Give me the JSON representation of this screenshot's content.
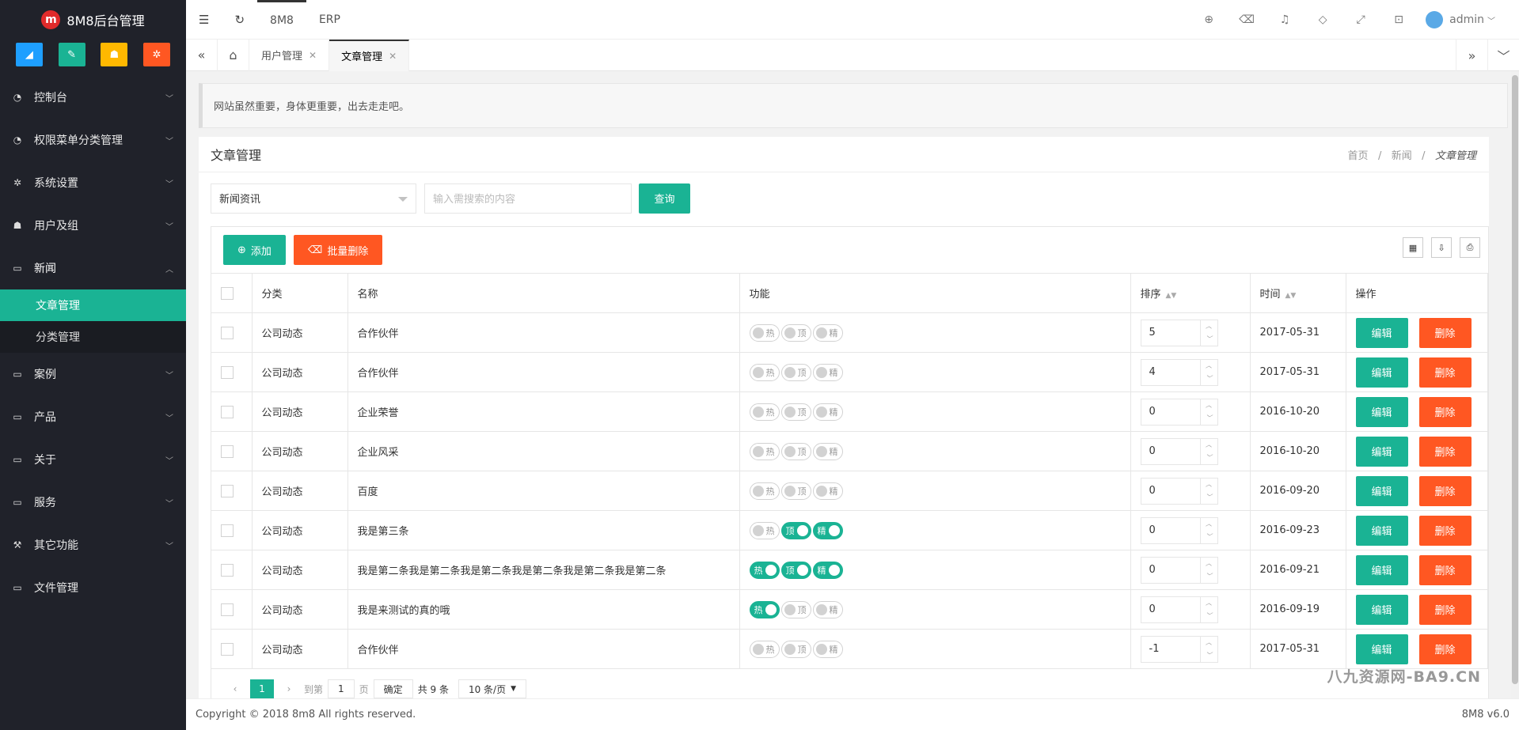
{
  "app": {
    "logo_letter": "m",
    "title": "8M8后台管理"
  },
  "quick_icons": [
    {
      "icon": "chart-icon",
      "color": "#1e9fff"
    },
    {
      "icon": "edit-icon",
      "color": "#1ab394"
    },
    {
      "icon": "users-icon",
      "color": "#ffb800"
    },
    {
      "icon": "gears-icon",
      "color": "#ff5722"
    }
  ],
  "sidebar": {
    "items": [
      {
        "label": "控制台",
        "icon": "dashboard-icon"
      },
      {
        "label": "权限菜单分类管理",
        "icon": "dashboard-icon"
      },
      {
        "label": "系统设置",
        "icon": "gear-icon"
      },
      {
        "label": "用户及组",
        "icon": "users-icon"
      },
      {
        "label": "新闻",
        "icon": "monitor-icon",
        "expanded": true
      },
      {
        "label": "案例",
        "icon": "monitor-icon"
      },
      {
        "label": "产品",
        "icon": "monitor-icon"
      },
      {
        "label": "关于",
        "icon": "monitor-icon"
      },
      {
        "label": "服务",
        "icon": "monitor-icon"
      },
      {
        "label": "其它功能",
        "icon": "gavel-icon"
      },
      {
        "label": "文件管理",
        "icon": "monitor-icon"
      }
    ],
    "subitems": [
      {
        "label": "文章管理",
        "active": true
      },
      {
        "label": "分类管理",
        "active": false
      }
    ]
  },
  "topbar": {
    "tab1": "8M8",
    "tab2": "ERP",
    "user": "admin"
  },
  "tabs": [
    {
      "label": "用户管理",
      "active": false
    },
    {
      "label": "文章管理",
      "active": true
    }
  ],
  "notice": "网站虽然重要，身体更重要，出去走走吧。",
  "panel": {
    "title": "文章管理",
    "breadcrumb": [
      "首页",
      "新闻",
      "文章管理"
    ],
    "select_value": "新闻资讯",
    "search_placeholder": "输入需搜索的内容",
    "query_label": "查询",
    "add_label": "添加",
    "batch_delete_label": "批量删除"
  },
  "table": {
    "headers": [
      "分类",
      "名称",
      "功能",
      "排序",
      "时间",
      "操作"
    ],
    "switch_labels": [
      "热",
      "顶",
      "精"
    ],
    "edit_label": "编辑",
    "delete_label": "删除",
    "rows": [
      {
        "cat": "公司动态",
        "name": "合作伙伴",
        "hot": false,
        "top": false,
        "good": false,
        "order": "5",
        "date": "2017-05-31"
      },
      {
        "cat": "公司动态",
        "name": "合作伙伴",
        "hot": false,
        "top": false,
        "good": false,
        "order": "4",
        "date": "2017-05-31"
      },
      {
        "cat": "公司动态",
        "name": "企业荣誉",
        "hot": false,
        "top": false,
        "good": false,
        "order": "0",
        "date": "2016-10-20"
      },
      {
        "cat": "公司动态",
        "name": "企业风采",
        "hot": false,
        "top": false,
        "good": false,
        "order": "0",
        "date": "2016-10-20"
      },
      {
        "cat": "公司动态",
        "name": "百度",
        "hot": false,
        "top": false,
        "good": false,
        "order": "0",
        "date": "2016-09-20"
      },
      {
        "cat": "公司动态",
        "name": "我是第三条",
        "hot": false,
        "top": true,
        "good": true,
        "order": "0",
        "date": "2016-09-23"
      },
      {
        "cat": "公司动态",
        "name": "我是第二条我是第二条我是第二条我是第二条我是第二条我是第二条",
        "hot": true,
        "top": true,
        "good": true,
        "order": "0",
        "date": "2016-09-21"
      },
      {
        "cat": "公司动态",
        "name": "我是来测试的真的哦",
        "hot": true,
        "top": false,
        "good": false,
        "order": "0",
        "date": "2016-09-19"
      },
      {
        "cat": "公司动态",
        "name": "合作伙伴",
        "hot": false,
        "top": false,
        "good": false,
        "order": "-1",
        "date": "2017-05-31"
      }
    ]
  },
  "pager": {
    "current": "1",
    "goto_label": "到第",
    "goto_value": "1",
    "page_unit": "页",
    "confirm": "确定",
    "total": "共 9 条",
    "per_page": "10 条/页"
  },
  "footer": {
    "copyright": "Copyright © 2018 8m8 All rights reserved.",
    "version": "8M8 v6.0"
  },
  "watermark": "八九资源网-BA9.CN",
  "colors": {
    "accent": "#1ab394",
    "danger": "#ff5722",
    "sidebar": "#20222a"
  }
}
